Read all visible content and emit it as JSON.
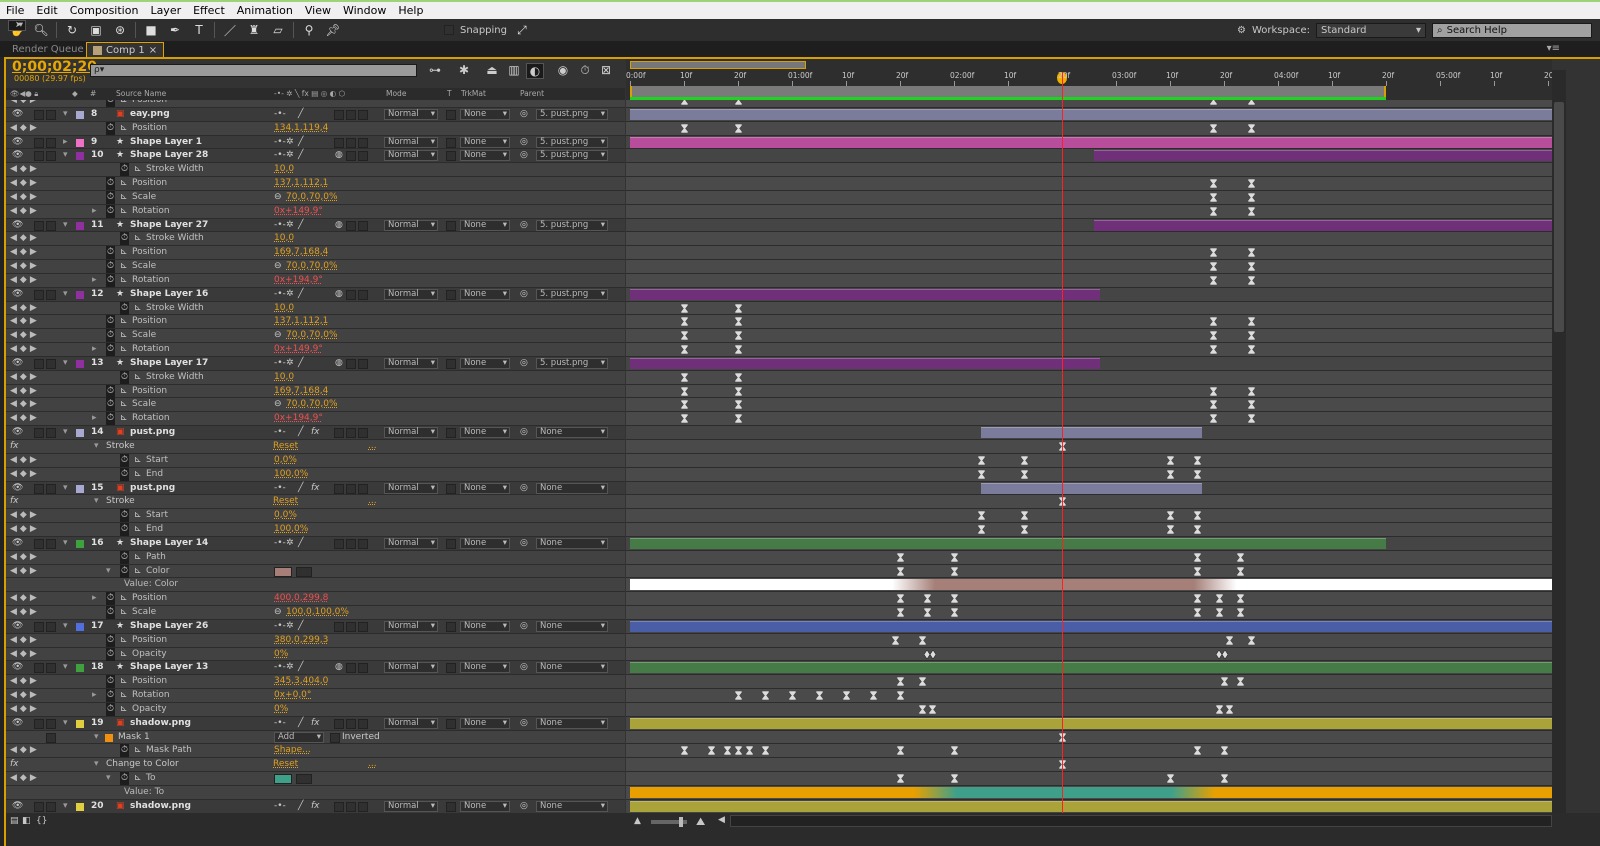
{
  "menu": [
    "File",
    "Edit",
    "Composition",
    "Layer",
    "Effect",
    "Animation",
    "View",
    "Window",
    "Help"
  ],
  "toolbar": {
    "snapping_label": "Snapping",
    "workspace_label": "Workspace:",
    "workspace_value": "Standard",
    "search_help_placeholder": "Search Help"
  },
  "tabs": [
    {
      "label": "Render Queue",
      "active": false
    },
    {
      "label": "Comp 1",
      "active": true,
      "close": "×"
    }
  ],
  "comp": {
    "timecode": "0;00;02;20",
    "frame_info": "00080 (29.97 fps)",
    "search_value": "ρ▾",
    "current_frame": 80,
    "work_area_end_frame": 140
  },
  "columns": {
    "source_name": "Source Name",
    "mode": "Mode",
    "t": "T",
    "trkmat": "TrkMat",
    "parent": "Parent",
    "number": "#"
  },
  "ruler": [
    {
      "f": 0,
      "label": "0:00f"
    },
    {
      "f": 10,
      "label": "10f"
    },
    {
      "f": 20,
      "label": "20f"
    },
    {
      "f": 30,
      "label": "01:00f"
    },
    {
      "f": 40,
      "label": "10f"
    },
    {
      "f": 50,
      "label": "20f"
    },
    {
      "f": 60,
      "label": "02:00f"
    },
    {
      "f": 70,
      "label": "10f"
    },
    {
      "f": 80,
      "label": "20f"
    },
    {
      "f": 90,
      "label": "03:00f"
    },
    {
      "f": 100,
      "label": "10f"
    },
    {
      "f": 110,
      "label": "20f"
    },
    {
      "f": 120,
      "label": "04:00f"
    },
    {
      "f": 130,
      "label": "10f"
    },
    {
      "f": 140,
      "label": "20f"
    },
    {
      "f": 150,
      "label": "05:00f"
    },
    {
      "f": 160,
      "label": "10f"
    },
    {
      "f": 170,
      "label": "20f"
    }
  ],
  "colors": {
    "accent": "#d7a000",
    "cti": "#ff2020",
    "value": "#e0a020",
    "value_red": "#f05050"
  },
  "rows": [
    {
      "t": "prop",
      "name": "Position",
      "value": "",
      "keys": [
        10,
        20,
        108,
        115
      ]
    },
    {
      "t": "layer",
      "num": "8",
      "name": "eay.png",
      "src": "footage",
      "label": "#a8a8d0",
      "bar": [
        0,
        999
      ],
      "barColor": "#7b7b9b",
      "twirl": "open",
      "fx": false,
      "sun": false,
      "mb": false,
      "mode": "Normal",
      "trkmat": "None",
      "parent": "5. pust.png"
    },
    {
      "t": "prop",
      "name": "Position",
      "value": "134,1,119,4",
      "keys": [
        10,
        20,
        108,
        115
      ]
    },
    {
      "t": "layer",
      "num": "9",
      "name": "Shape Layer 1",
      "src": "shape",
      "label": "#f070c8",
      "bar": [
        0,
        999
      ],
      "barColor": "#b84d9c",
      "twirl": "closed",
      "fx": false,
      "sun": true,
      "mb": false,
      "mode": "Normal",
      "trkmat": "None",
      "parent": "5. pust.png"
    },
    {
      "t": "layer",
      "num": "10",
      "name": "Shape Layer 28",
      "src": "shape",
      "label": "#9030a0",
      "bar": [
        86,
        999
      ],
      "barColor": "#6f3079",
      "twirl": "open",
      "fx": false,
      "sun": true,
      "mb": true,
      "mode": "Normal",
      "trkmat": "None",
      "parent": "5. pust.png"
    },
    {
      "t": "prop",
      "name": "Stroke Width",
      "value": "10,0",
      "nested": true,
      "keys": []
    },
    {
      "t": "prop",
      "name": "Position",
      "value": "137,1,112,1",
      "keys": [
        108,
        115
      ]
    },
    {
      "t": "prop",
      "name": "Scale",
      "value": "70,0,70,0%",
      "link": true,
      "keys": [
        108,
        115
      ]
    },
    {
      "t": "prop",
      "name": "Rotation",
      "value": "0x+149,9°",
      "red": true,
      "twirl": true,
      "keys": [
        108,
        115
      ]
    },
    {
      "t": "layer",
      "num": "11",
      "name": "Shape Layer 27",
      "src": "shape",
      "label": "#9030a0",
      "bar": [
        86,
        999
      ],
      "barColor": "#6f3079",
      "twirl": "open",
      "fx": false,
      "sun": true,
      "mb": true,
      "mode": "Normal",
      "trkmat": "None",
      "parent": "5. pust.png"
    },
    {
      "t": "prop",
      "name": "Stroke Width",
      "value": "10,0",
      "nested": true,
      "keys": []
    },
    {
      "t": "prop",
      "name": "Position",
      "value": "169,7,168,4",
      "keys": [
        108,
        115
      ]
    },
    {
      "t": "prop",
      "name": "Scale",
      "value": "70,0,70,0%",
      "link": true,
      "keys": [
        108,
        115
      ]
    },
    {
      "t": "prop",
      "name": "Rotation",
      "value": "0x+194,9°",
      "red": true,
      "twirl": true,
      "keys": [
        108,
        115
      ]
    },
    {
      "t": "layer",
      "num": "12",
      "name": "Shape Layer 16",
      "src": "shape",
      "label": "#9030a0",
      "bar": [
        0,
        87
      ],
      "barColor": "#6f3079",
      "twirl": "open",
      "fx": false,
      "sun": true,
      "mb": true,
      "mode": "Normal",
      "trkmat": "None",
      "parent": "5. pust.png"
    },
    {
      "t": "prop",
      "name": "Stroke Width",
      "value": "10,0",
      "nested": true,
      "keys": [
        10,
        20
      ]
    },
    {
      "t": "prop",
      "name": "Position",
      "value": "137,1,112,1",
      "keys": [
        10,
        20,
        108,
        115
      ]
    },
    {
      "t": "prop",
      "name": "Scale",
      "value": "70,0,70,0%",
      "link": true,
      "keys": [
        10,
        20,
        108,
        115
      ]
    },
    {
      "t": "prop",
      "name": "Rotation",
      "value": "0x+149,9°",
      "red": true,
      "twirl": true,
      "keys": [
        10,
        20,
        108,
        115
      ]
    },
    {
      "t": "layer",
      "num": "13",
      "name": "Shape Layer 17",
      "src": "shape",
      "label": "#9030a0",
      "bar": [
        0,
        87
      ],
      "barColor": "#6f3079",
      "twirl": "open",
      "fx": false,
      "sun": true,
      "mb": true,
      "mode": "Normal",
      "trkmat": "None",
      "parent": "5. pust.png"
    },
    {
      "t": "prop",
      "name": "Stroke Width",
      "value": "10,0",
      "nested": true,
      "keys": [
        10,
        20
      ]
    },
    {
      "t": "prop",
      "name": "Position",
      "value": "169,7,168,4",
      "keys": [
        10,
        20,
        108,
        115
      ]
    },
    {
      "t": "prop",
      "name": "Scale",
      "value": "70,0,70,0%",
      "link": true,
      "keys": [
        10,
        20,
        108,
        115
      ]
    },
    {
      "t": "prop",
      "name": "Rotation",
      "value": "0x+194,9°",
      "red": true,
      "twirl": true,
      "keys": [
        10,
        20,
        108,
        115
      ]
    },
    {
      "t": "layer",
      "num": "14",
      "name": "pust.png",
      "src": "footage",
      "label": "#a8a8d0",
      "bar": [
        65,
        106
      ],
      "barColor": "#7b7b9b",
      "twirl": "open",
      "fx": true,
      "sun": false,
      "mb": false,
      "mode": "Normal",
      "trkmat": "None",
      "parent": "None"
    },
    {
      "t": "fx",
      "name": "Stroke",
      "value": "Reset",
      "dots": "...",
      "keys": [
        80
      ]
    },
    {
      "t": "prop",
      "name": "Start",
      "value": "0,0%",
      "fxprop": true,
      "keys": [
        65,
        73,
        100,
        105
      ]
    },
    {
      "t": "prop",
      "name": "End",
      "value": "100,0%",
      "fxprop": true,
      "keys": [
        65,
        73,
        100,
        105
      ]
    },
    {
      "t": "layer",
      "num": "15",
      "name": "pust.png",
      "src": "footage",
      "label": "#a8a8d0",
      "bar": [
        65,
        106
      ],
      "barColor": "#7b7b9b",
      "twirl": "open",
      "fx": true,
      "sun": false,
      "mb": false,
      "mode": "Normal",
      "trkmat": "None",
      "parent": "None"
    },
    {
      "t": "fx",
      "name": "Stroke",
      "value": "Reset",
      "dots": "...",
      "keys": [
        80
      ]
    },
    {
      "t": "prop",
      "name": "Start",
      "value": "0,0%",
      "fxprop": true,
      "keys": [
        65,
        73,
        100,
        105
      ]
    },
    {
      "t": "prop",
      "name": "End",
      "value": "100,0%",
      "fxprop": true,
      "keys": [
        65,
        73,
        100,
        105
      ]
    },
    {
      "t": "layer",
      "num": "16",
      "name": "Shape Layer 14",
      "src": "shape",
      "label": "#40a040",
      "bar": [
        0,
        140
      ],
      "barColor": "#467a46",
      "twirl": "open",
      "fx": false,
      "sun": true,
      "mb": false,
      "mode": "Normal",
      "trkmat": "None",
      "parent": "None"
    },
    {
      "t": "prop",
      "name": "Path",
      "value": "",
      "nested": true,
      "keys": [
        50,
        60,
        105,
        113
      ]
    },
    {
      "t": "prop",
      "name": "Color",
      "value": "",
      "swatch": "#a57f78",
      "nested": true,
      "twirlOpen": true,
      "keys": [
        50,
        60,
        105,
        113
      ]
    },
    {
      "t": "graph",
      "name": "Value: Color",
      "base": "#ffffff",
      "mid": "#a57f78",
      "ramp": [
        48,
        56,
        104,
        112
      ]
    },
    {
      "t": "prop",
      "name": "Position",
      "value": "400,0,299,8",
      "red": true,
      "twirl": true,
      "keys": [
        50,
        55,
        60,
        105,
        109,
        113
      ]
    },
    {
      "t": "prop",
      "name": "Scale",
      "value": "100,0,100,0%",
      "link": true,
      "keys": [
        50,
        55,
        60,
        105,
        109,
        113
      ]
    },
    {
      "t": "layer",
      "num": "17",
      "name": "Shape Layer 26",
      "src": "shape",
      "label": "#5070e0",
      "bar": [
        0,
        999
      ],
      "barColor": "#4a5ea8",
      "twirl": "open",
      "fx": false,
      "sun": true,
      "mb": false,
      "mode": "Normal",
      "trkmat": "None",
      "parent": "None"
    },
    {
      "t": "prop",
      "name": "Position",
      "value": "380,0,299,3",
      "keys": [
        49,
        54,
        111,
        115
      ]
    },
    {
      "t": "prop",
      "name": "Opacity",
      "value": "0%",
      "keytype": "diamond",
      "keys": [
        55,
        109
      ]
    },
    {
      "t": "layer",
      "num": "18",
      "name": "Shape Layer 13",
      "src": "shape",
      "label": "#40a040",
      "bar": [
        0,
        999
      ],
      "barColor": "#467a46",
      "twirl": "open",
      "fx": false,
      "sun": true,
      "mb": true,
      "mode": "Normal",
      "trkmat": "None",
      "parent": "None"
    },
    {
      "t": "prop",
      "name": "Position",
      "value": "345,3,404,0",
      "keys": [
        50,
        54,
        110,
        113
      ]
    },
    {
      "t": "prop",
      "name": "Rotation",
      "value": "0x+0,0°",
      "twirl": true,
      "keys": [
        20,
        25,
        30,
        35,
        40,
        45,
        50
      ]
    },
    {
      "t": "prop",
      "name": "Opacity",
      "value": "0%",
      "keys": [
        54,
        56,
        109,
        111
      ]
    },
    {
      "t": "layer",
      "num": "19",
      "name": "shadow.png",
      "src": "footage",
      "label": "#e0d040",
      "bar": [
        0,
        999
      ],
      "barColor": "#aaa33a",
      "twirl": "open",
      "fx": true,
      "sun": false,
      "mb": false,
      "mode": "Normal",
      "trkmat": "None",
      "parent": "None"
    },
    {
      "t": "mask",
      "name": "Mask 1",
      "mode": "Add",
      "inverted": "Inverted",
      "maskColor": "#f09010",
      "keys": [
        80
      ]
    },
    {
      "t": "prop",
      "name": "Mask Path",
      "value": "Shape...",
      "fxprop": true,
      "keys": [
        10,
        15,
        18,
        20,
        22,
        25,
        50,
        60,
        105,
        110
      ]
    },
    {
      "t": "fx",
      "name": "Change to Color",
      "value": "Reset",
      "dots": "...",
      "keys": [
        80
      ]
    },
    {
      "t": "prop",
      "name": "To",
      "value": "",
      "swatch": "#3fa08a",
      "fxprop": true,
      "twirlOpen": true,
      "keys": [
        50,
        60,
        100,
        110
      ]
    },
    {
      "t": "graph",
      "name": "Value: To",
      "base": "#e8a000",
      "mid": "#3fa08a",
      "ramp": [
        52,
        60,
        100,
        108
      ]
    },
    {
      "t": "layer",
      "num": "20",
      "name": "shadow.png",
      "src": "footage",
      "label": "#e0d040",
      "bar": [
        0,
        999
      ],
      "barColor": "#aaa33a",
      "twirl": "open",
      "fx": true,
      "sun": false,
      "mb": false,
      "mode": "Normal",
      "trkmat": "None",
      "parent": "None"
    }
  ]
}
